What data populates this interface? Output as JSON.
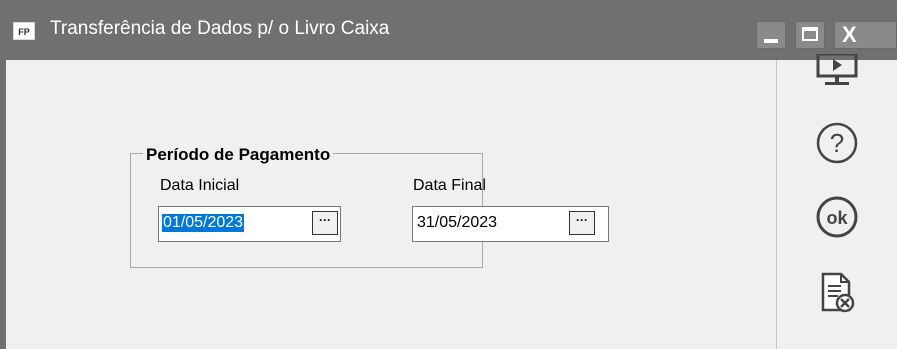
{
  "window": {
    "app_icon_label": "FP",
    "title": "Transferência de Dados p/ o Livro Caixa",
    "controls": {
      "close_glyph": "X"
    }
  },
  "form": {
    "group_title": "Período de Pagamento",
    "start_date": {
      "label": "Data Inicial",
      "value": "01/05/2023",
      "button_label": "···"
    },
    "end_date": {
      "label": "Data Final",
      "value": "31/05/2023",
      "button_label": "···"
    }
  },
  "side_panel": {
    "icons": [
      "preview-icon",
      "help-icon",
      "ok-icon",
      "cancel-report-icon"
    ],
    "ok_label": "ok",
    "help_label": "?"
  },
  "colors": {
    "titlebar": "#707070",
    "selection": "#0078d7",
    "background": "#f0f0f0"
  }
}
